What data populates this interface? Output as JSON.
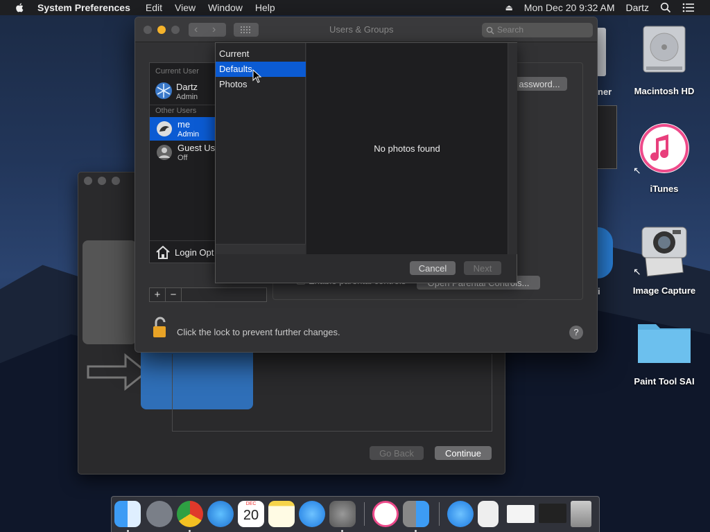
{
  "menubar": {
    "app_name": "System Preferences",
    "items": [
      "Edit",
      "View",
      "Window",
      "Help"
    ],
    "datetime": "Mon Dec 20  9:32 AM",
    "user": "Dartz"
  },
  "back_window": {
    "go_back_label": "Go Back",
    "continue_label": "Continue"
  },
  "main_window": {
    "title": "Users & Groups",
    "search_placeholder": "Search",
    "current_user_section": "Current User",
    "other_users_section": "Other Users",
    "users": [
      {
        "name": "Dartz",
        "role": "Admin"
      },
      {
        "name": "me",
        "role": "Admin"
      },
      {
        "name": "Guest Us",
        "role": "Off"
      }
    ],
    "login_options_label": "Login Opt",
    "add_label": "+",
    "remove_label": "−",
    "password_button_label": "assword...",
    "enable_parental_label": "Enable parental controls",
    "open_parental_label": "Open Parental Controls...",
    "lock_text": "Click the lock to prevent further changes.",
    "help_label": "?"
  },
  "photo_sheet": {
    "sources": [
      {
        "label": "Current",
        "selected": false
      },
      {
        "label": "Defaults",
        "selected": true
      },
      {
        "label": "Photos",
        "selected": false
      }
    ],
    "empty_message": "No photos found",
    "cancel_label": "Cancel",
    "next_label": "Next"
  },
  "desktop_icons": [
    {
      "label": "Macintosh HD"
    },
    {
      "label": "iTunes"
    },
    {
      "label": "Image Capture"
    },
    {
      "label": "Paint Tool SAI"
    }
  ],
  "partial_labels": {
    "right_edge_1": "ner",
    "right_edge_2": "i",
    "calendar_day": "20",
    "calendar_month": "DEC"
  },
  "colors": {
    "selection_blue": "#0b5bd3",
    "window_bg": "#323234",
    "accent_yellow": "#f5b32b"
  }
}
